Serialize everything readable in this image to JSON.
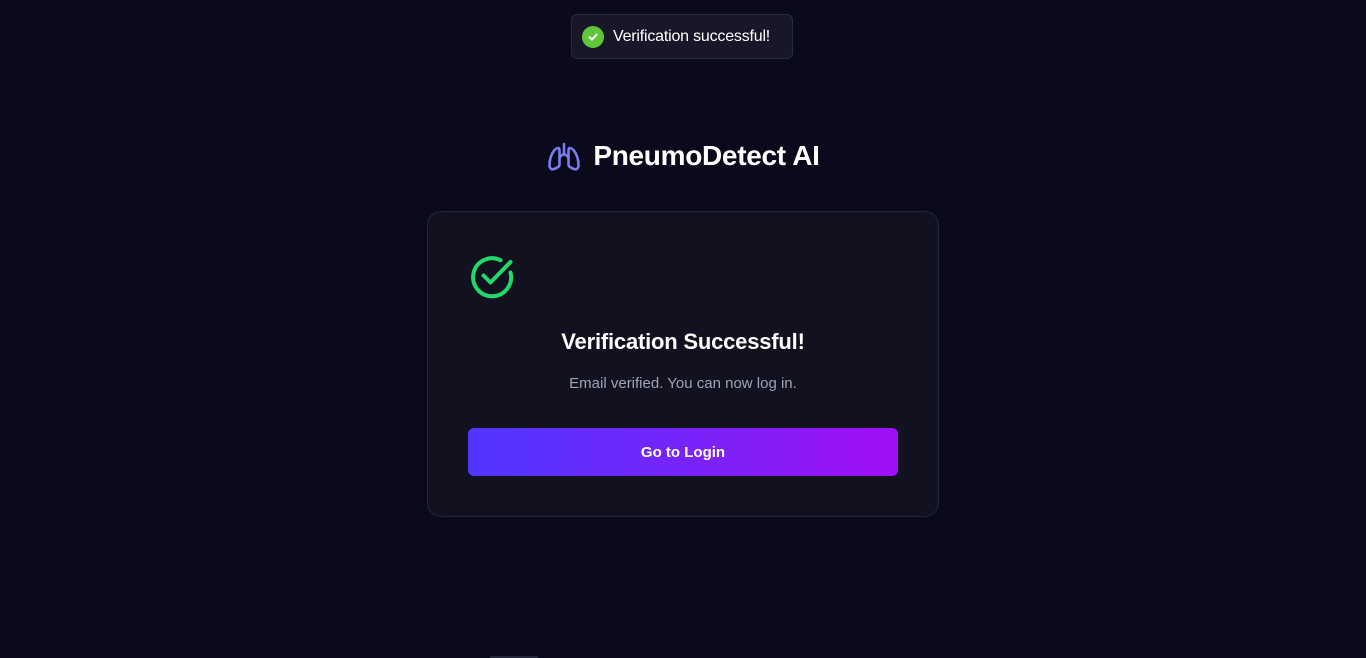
{
  "toast": {
    "message": "Verification successful!",
    "icon": "check-circle-icon",
    "icon_color": "#5fc63a"
  },
  "brand": {
    "title": "PneumoDetect AI",
    "icon": "lungs-icon",
    "icon_color": "#7b7bf0"
  },
  "card": {
    "icon": "check-circle-icon",
    "icon_color": "#22d86a",
    "title": "Verification Successful!",
    "message": "Email verified. You can now log in.",
    "button_label": "Go to Login"
  },
  "colors": {
    "background": "#0a0a1c",
    "card_background": "#11111f",
    "button_gradient_start": "#5036ff",
    "button_gradient_end": "#a10ff7"
  }
}
